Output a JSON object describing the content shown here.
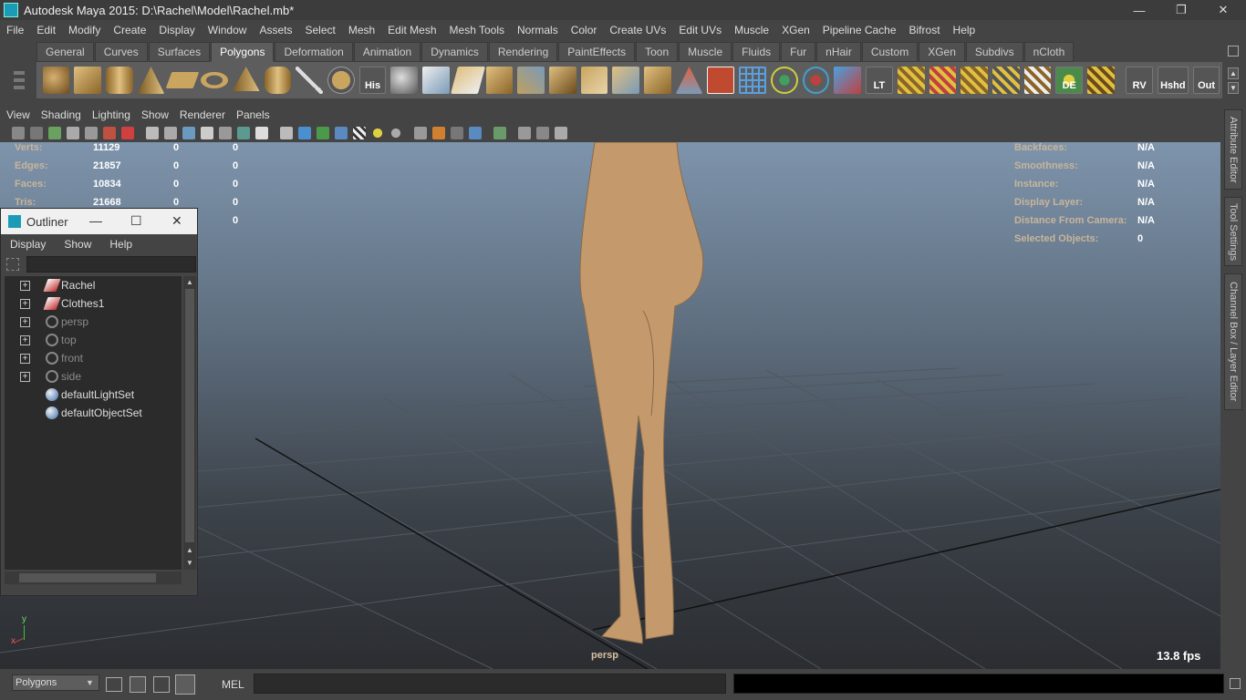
{
  "window": {
    "title": "Autodesk Maya 2015: D:\\Rachel\\Model\\Rachel.mb*",
    "minimize": "—",
    "restore": "❐",
    "close": "✕"
  },
  "menubar": [
    "File",
    "Edit",
    "Modify",
    "Create",
    "Display",
    "Window",
    "Assets",
    "Select",
    "Mesh",
    "Edit Mesh",
    "Mesh Tools",
    "Normals",
    "Color",
    "Create UVs",
    "Edit UVs",
    "Muscle",
    "XGen",
    "Pipeline Cache",
    "Bifrost",
    "Help"
  ],
  "shelf": {
    "tabs": [
      "General",
      "Curves",
      "Surfaces",
      "Polygons",
      "Deformation",
      "Animation",
      "Dynamics",
      "Rendering",
      "PaintEffects",
      "Toon",
      "Muscle",
      "Fluids",
      "Fur",
      "nHair",
      "Custom",
      "XGen",
      "Subdivs",
      "nCloth"
    ],
    "active_tab": "Polygons",
    "text_icons": {
      "his": "His",
      "lt": "LT",
      "de": "DE",
      "rv": "RV",
      "hshd": "Hshd",
      "out": "Out"
    },
    "scroll_up": "▲",
    "scroll_down": "▼"
  },
  "panel_menu": [
    "View",
    "Shading",
    "Lighting",
    "Show",
    "Renderer",
    "Panels"
  ],
  "hud_left": {
    "rows": [
      {
        "label": "Verts:",
        "a": "11129",
        "b": "0",
        "c": "0"
      },
      {
        "label": "Edges:",
        "a": "21857",
        "b": "0",
        "c": "0"
      },
      {
        "label": "Faces:",
        "a": "10834",
        "b": "0",
        "c": "0"
      },
      {
        "label": "Tris:",
        "a": "21668",
        "b": "0",
        "c": "0"
      },
      {
        "label": "",
        "a": "",
        "b": "0",
        "c": "0"
      }
    ]
  },
  "hud_right": {
    "rows": [
      {
        "label": "Backfaces:",
        "value": "N/A"
      },
      {
        "label": "Smoothness:",
        "value": "N/A"
      },
      {
        "label": "Instance:",
        "value": "N/A"
      },
      {
        "label": "Display Layer:",
        "value": "N/A"
      },
      {
        "label": "Distance From Camera:",
        "value": "N/A"
      },
      {
        "label": "Selected Objects:",
        "value": "0"
      }
    ]
  },
  "viewport": {
    "camera": "persp",
    "fps": "13.8 fps",
    "axis_x": "x",
    "axis_y": "y"
  },
  "outliner": {
    "title": "Outliner",
    "menu": [
      "Display",
      "Show",
      "Help"
    ],
    "items": [
      {
        "label": "Rachel",
        "expandable": true,
        "dim": false,
        "icon": "mesh-icon"
      },
      {
        "label": "Clothes1",
        "expandable": true,
        "dim": false,
        "icon": "mesh-icon"
      },
      {
        "label": "persp",
        "expandable": true,
        "dim": true,
        "icon": "camera-icon"
      },
      {
        "label": "top",
        "expandable": true,
        "dim": true,
        "icon": "camera-icon"
      },
      {
        "label": "front",
        "expandable": true,
        "dim": true,
        "icon": "camera-icon"
      },
      {
        "label": "side",
        "expandable": true,
        "dim": true,
        "icon": "camera-icon"
      },
      {
        "label": "defaultLightSet",
        "expandable": false,
        "dim": false,
        "icon": "set-icon"
      },
      {
        "label": "defaultObjectSet",
        "expandable": false,
        "dim": false,
        "icon": "set-icon"
      }
    ],
    "expand_glyph": "+"
  },
  "side_tabs": [
    "Attribute Editor",
    "Tool Settings",
    "Channel Box / Layer Editor"
  ],
  "statusbar": {
    "menu_set": "Polygons",
    "dropdown_arrow": "▼",
    "mel_label": "MEL"
  }
}
